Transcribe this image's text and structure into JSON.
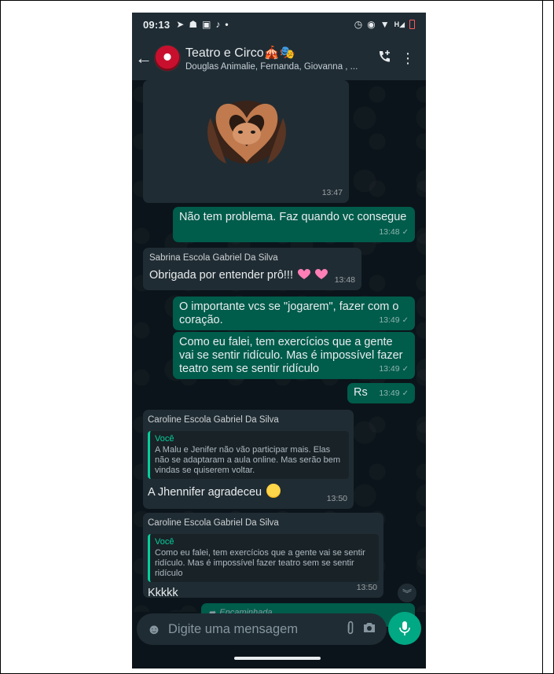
{
  "status_bar": {
    "time": "09:13",
    "left_icons": [
      "telegram-icon",
      "game-icon",
      "youtube-icon",
      "tiktok-icon",
      "dot-icon"
    ],
    "right_icons": [
      "alarm-icon",
      "data-saver-icon",
      "wifi-icon",
      "signal-icon",
      "battery-low-icon"
    ],
    "signal_label": "H"
  },
  "header": {
    "group_name": "Teatro e Circo",
    "group_emojis": "🎪🎭",
    "members": "Douglas Animalie, Fernanda, Giovanna , ..."
  },
  "messages": [
    {
      "id": "sticker",
      "type": "incoming",
      "time": "13:47"
    },
    {
      "id": "m1",
      "type": "outgoing",
      "text": "Não tem problema. Faz  quando vc consegue",
      "time": "13:48",
      "check": "✓"
    },
    {
      "id": "m2",
      "type": "incoming",
      "sender": "Sabrina Escola Gabriel Da Silva",
      "text": "Obrigada por entender prô!!!",
      "time": "13:48"
    },
    {
      "id": "m3",
      "type": "outgoing",
      "text": "O importante vcs se \"jogarem\", fazer com o coração.",
      "time": "13:49",
      "check": "✓"
    },
    {
      "id": "m4",
      "type": "outgoing",
      "text": "Como eu falei, tem exercícios que a gente vai se sentir ridículo. Mas é impossível fazer teatro sem se sentir ridículo",
      "time": "13:49",
      "check": "✓"
    },
    {
      "id": "m5",
      "type": "outgoing",
      "text": "Rs",
      "time": "13:49",
      "check": "✓"
    },
    {
      "id": "m6",
      "type": "incoming",
      "sender": "Caroline Escola Gabriel Da Silva",
      "quote_author": "Você",
      "quote_text": "A Malu e Jenifer não vão participar mais. Elas não se adaptaram a aula online. Mas serão bem vindas se quiserem voltar.",
      "text": "A Jhennifer agradeceu",
      "time": "13:50"
    },
    {
      "id": "m7",
      "type": "incoming",
      "sender": "Caroline Escola Gabriel Da Silva",
      "quote_author": "Você",
      "quote_text": "Como eu falei, tem exercícios que a gente vai se sentir ridículo. Mas é impossível fazer teatro sem se sentir ridículo",
      "text": "Kkkkk",
      "time": "13:50"
    },
    {
      "id": "m8",
      "type": "outgoing",
      "forwarded_label": "Encaminhada"
    }
  ],
  "input": {
    "placeholder": "Digite uma mensagem"
  },
  "colors": {
    "header_bg": "#1f2c34",
    "chat_bg": "#0b141a",
    "incoming_bubble": "#202c33",
    "outgoing_bubble": "#005c4b",
    "accent": "#00a884"
  }
}
